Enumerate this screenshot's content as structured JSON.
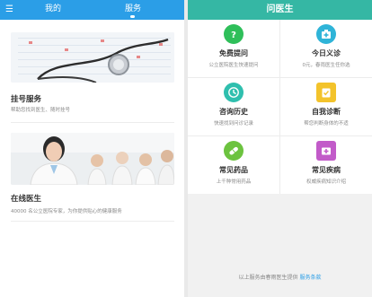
{
  "left": {
    "tabs": [
      {
        "label": "我的"
      },
      {
        "label": "服务"
      }
    ],
    "cards": [
      {
        "title": "挂号服务",
        "subtitle": "帮助您找到医生、随时挂号"
      },
      {
        "title": "在线医生",
        "subtitle": "40000 名公立医院专家，为你提供贴心的健康服务"
      }
    ]
  },
  "right": {
    "header_title": "问医生",
    "items": [
      {
        "label": "免费提问",
        "desc": "公立医院医生快速提问",
        "icon": "question-bubble-icon",
        "color": "#2fbf5a"
      },
      {
        "label": "今日义诊",
        "desc": "0元，春雨医生任你选",
        "icon": "medical-kit-icon",
        "color": "#2fb4d8"
      },
      {
        "label": "咨询历史",
        "desc": "快速找到问诊记录",
        "icon": "clock-icon",
        "color": "#2fbfae"
      },
      {
        "label": "自我诊断",
        "desc": "帮您判断身体的不适",
        "icon": "clipboard-check-icon",
        "color": "#f3c32b"
      },
      {
        "label": "常见药品",
        "desc": "上千种常用药品",
        "icon": "pill-icon",
        "color": "#6cc33f"
      },
      {
        "label": "常见疾病",
        "desc": "权威疾病知识介绍",
        "icon": "medical-box-icon",
        "color": "#c25bc9"
      }
    ],
    "footer_text": "以上服务由春雨医生提供",
    "footer_link": "服务条款"
  }
}
